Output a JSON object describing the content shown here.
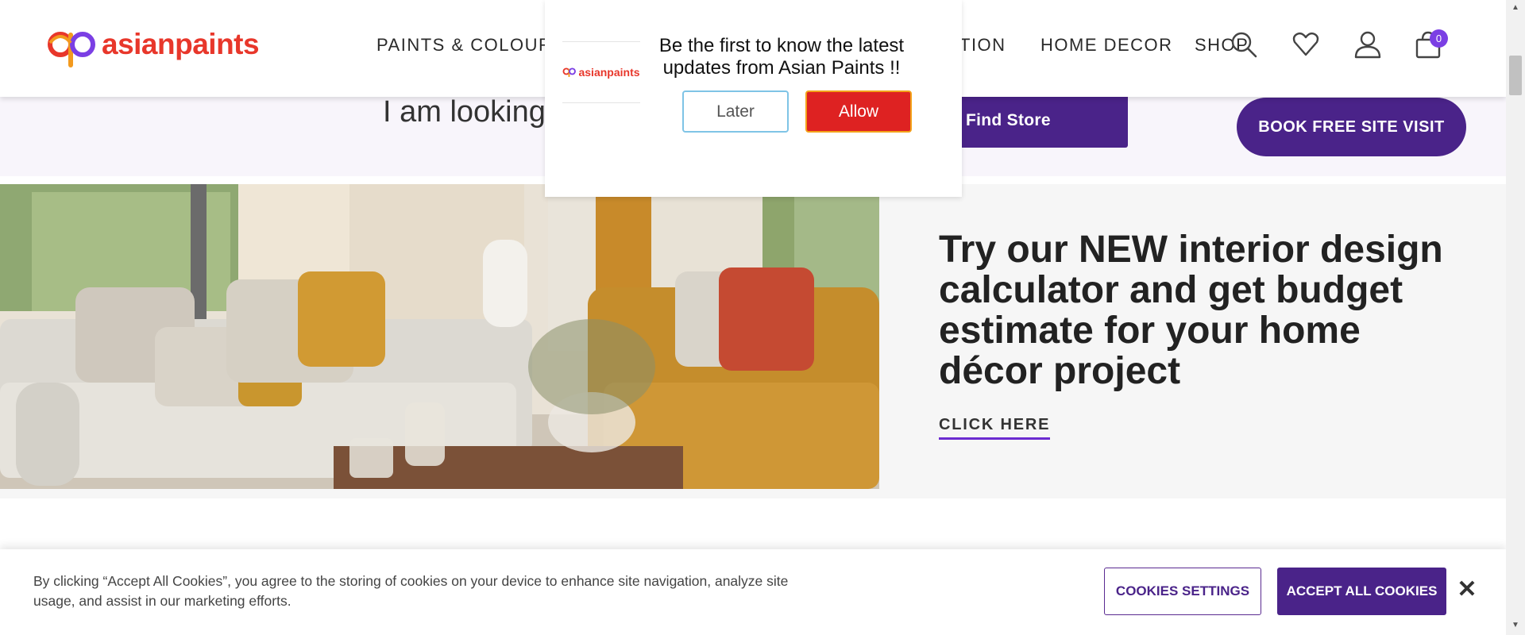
{
  "header": {
    "brand": "asianpaints",
    "nav": [
      "PAINTS & COLOURS",
      "TION",
      "HOME DECOR",
      "SHOP"
    ],
    "cart_count": "0",
    "icons": [
      "search-icon",
      "wishlist-heart-icon",
      "user-icon",
      "cart-icon"
    ]
  },
  "strip": {
    "looking_text": "I am looking",
    "find_store": "Find Store",
    "book_visit": "BOOK FREE SITE VISIT"
  },
  "hero": {
    "heading": "Try our NEW interior design calculator and get budget estimate for your home décor project",
    "cta": "CLICK HERE"
  },
  "notification": {
    "brand": "asianpaints",
    "message": "Be the first to know the latest updates from Asian Paints !!",
    "later": "Later",
    "allow": "Allow"
  },
  "cookie": {
    "text": "By clicking “Accept All Cookies”, you agree to the storing of cookies on your device to enhance site navigation, analyze site usage, and assist in our marketing efforts.",
    "settings": "COOKIES SETTINGS",
    "accept": "ACCEPT ALL COOKIES",
    "close": "✕"
  },
  "colors": {
    "brand_purple": "#4a2389",
    "brand_red": "#e8372b",
    "badge_purple": "#7b3fe4",
    "allow_red": "#de2222"
  }
}
